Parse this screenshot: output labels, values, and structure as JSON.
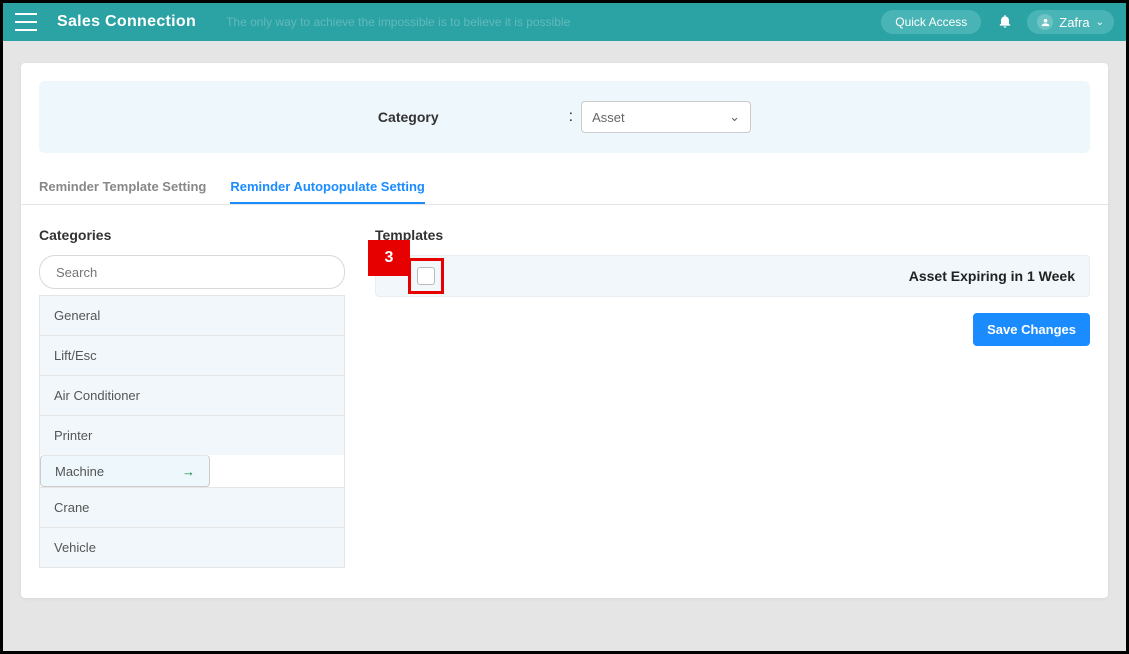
{
  "header": {
    "brand": "Sales Connection",
    "subtitle": "The only way to achieve the impossible is to believe it is possible",
    "quick_access": "Quick Access",
    "user_name": "Zafra"
  },
  "category_bar": {
    "label": "Category",
    "selected": "Asset"
  },
  "tabs": {
    "t1": "Reminder Template Setting",
    "t2": "Reminder Autopopulate Setting"
  },
  "sections": {
    "categories_title": "Categories",
    "templates_title": "Templates",
    "search_placeholder": "Search"
  },
  "categories": {
    "c0": "General",
    "c1": "Lift/Esc",
    "c2": "Air Conditioner",
    "c3": "Printer",
    "c4": "Machine",
    "c5": "Crane",
    "c6": "Vehicle"
  },
  "template_row": {
    "title": "Asset Expiring in 1 Week"
  },
  "buttons": {
    "save": "Save Changes"
  },
  "annotation": {
    "step": "3"
  }
}
